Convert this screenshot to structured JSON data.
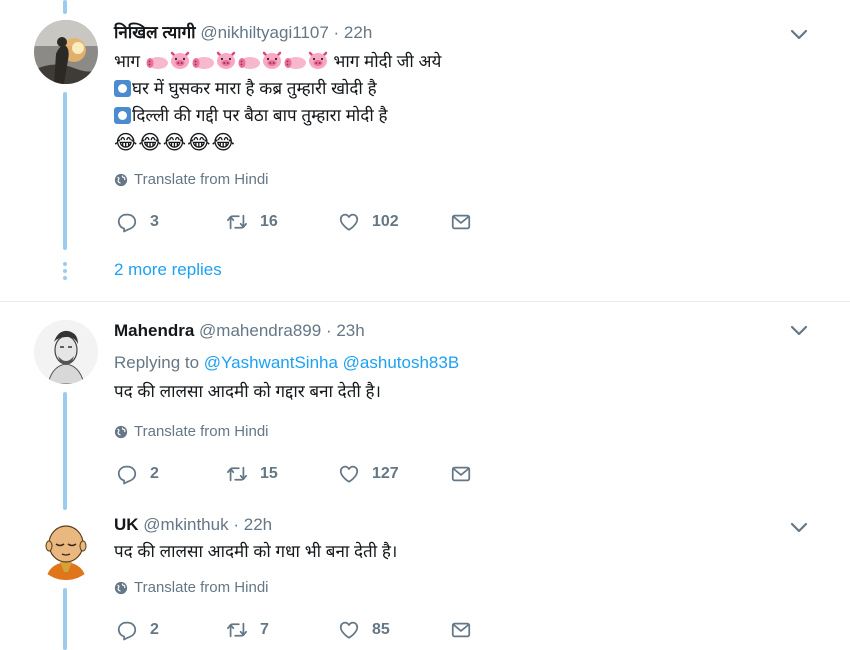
{
  "tweets": [
    {
      "name": "निखिल त्यागी",
      "handle": "@nikhiltyagi1107",
      "time": "22h",
      "lines": {
        "first_start": "भाग",
        "first_end": "भाग मोदी जी अये",
        "second": "घर में घुसकर मारा है कब्र तुम्हारी खोदी है",
        "third": "दिल्ली की गद्दी पर बैठा बाप तुम्हारा मोदी है",
        "emojis": "😂😂😂😂😂"
      },
      "translate": "Translate from Hindi",
      "replies": "3",
      "retweets": "16",
      "likes": "102",
      "more_replies": "2 more replies"
    },
    {
      "name": "Mahendra",
      "handle": "@mahendra899",
      "time": "23h",
      "replying_label": "Replying to",
      "replying_to": [
        "@YashwantSinha",
        "@ashutosh83B"
      ],
      "text": "पद की लालसा आदमी को गद्दार बना देती है।",
      "translate": "Translate from Hindi",
      "replies": "2",
      "retweets": "15",
      "likes": "127"
    },
    {
      "name": "UK",
      "handle": "@mkinthuk",
      "time": "22h",
      "text": "पद की लालसा आदमी को गधा भी बना देती है।",
      "translate": "Translate from Hindi",
      "replies": "2",
      "retweets": "7",
      "likes": "85"
    }
  ],
  "separator": "·",
  "colors": {
    "link": "#1da1f2",
    "muted": "#657786",
    "thread_line": "#9ccbf0",
    "text": "#14171a"
  },
  "icons": [
    "reply-icon",
    "retweet-icon",
    "like-icon",
    "message-icon",
    "globe-icon",
    "chevron-down-icon",
    "pig-icon",
    "pig-nose-icon"
  ]
}
